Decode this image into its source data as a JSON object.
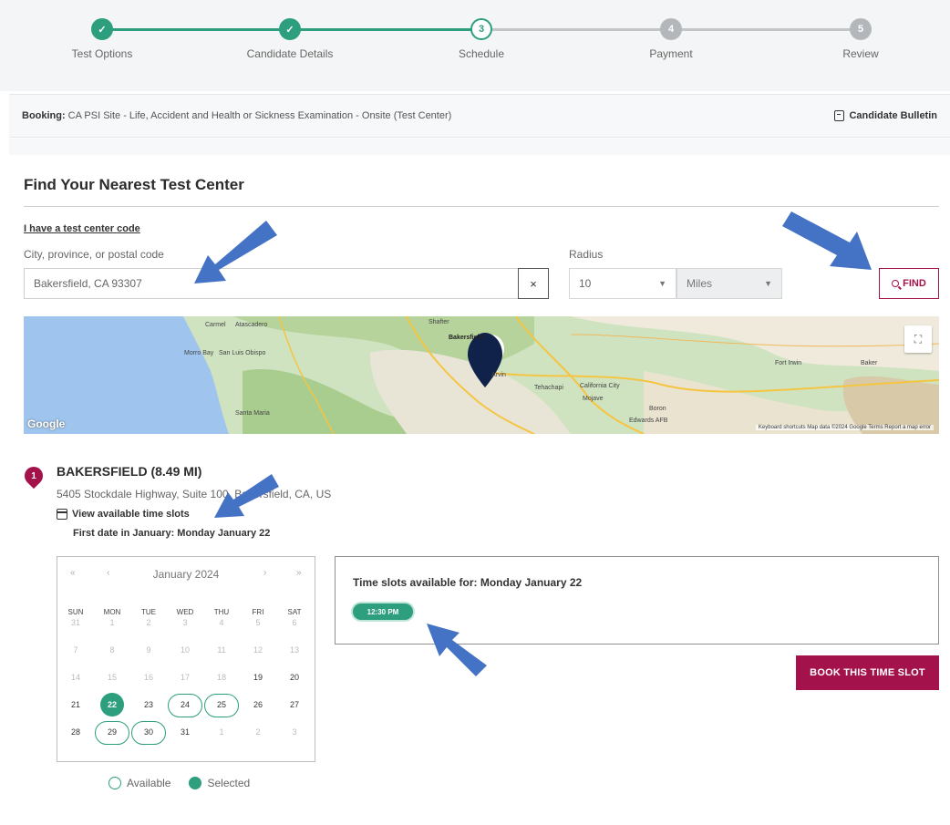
{
  "stepper": {
    "steps": [
      {
        "label": "Test Options",
        "state": "done"
      },
      {
        "label": "Candidate Details",
        "state": "done"
      },
      {
        "label": "Schedule",
        "state": "current",
        "number": "3"
      },
      {
        "label": "Payment",
        "state": "todo",
        "number": "4"
      },
      {
        "label": "Review",
        "state": "todo",
        "number": "5"
      }
    ]
  },
  "booking": {
    "label": "Booking:",
    "value": "CA PSI Site - Life, Accident and Health or Sickness Examination - Onsite (Test Center)",
    "bulletin": "Candidate Bulletin"
  },
  "find": {
    "title": "Find Your Nearest Test Center",
    "code_link": "I have a test center code",
    "city_label": "City, province, or postal code",
    "city_value": "Bakersfield, CA 93307",
    "clear": "×",
    "radius_label": "Radius",
    "radius_value": "10",
    "unit_value": "Miles",
    "find_button": "FIND"
  },
  "map": {
    "google": "Google",
    "footer": "Keyboard shortcuts   Map data ©2024 Google   Terms   Report a map error",
    "expand": "⛶",
    "towns": [
      "Carmel",
      "Atascadero",
      "Morro Bay",
      "San Luis Obispo",
      "Santa Maria",
      "Bakersfield",
      "Arvin",
      "Tehachapi",
      "California City",
      "Mojave",
      "Boron",
      "Edwards AFB",
      "Fort Irwin",
      "Baker",
      "Shafter"
    ]
  },
  "result": {
    "pin_number": "1",
    "name": "BAKERSFIELD (8.49 MI)",
    "address": "5405 Stockdale Highway, Suite 100, Bakersfield, CA, US",
    "slots_link": "View available time slots",
    "first_date": "First date in January: Monday January 22"
  },
  "calendar": {
    "nav_prev_year": "«",
    "nav_prev": "‹",
    "month": "January 2024",
    "nav_next": "›",
    "nav_next_year": "»",
    "weekdays": [
      "SUN",
      "MON",
      "TUE",
      "WED",
      "THU",
      "FRI",
      "SAT"
    ],
    "weeks": [
      [
        "31",
        "1",
        "2",
        "3",
        "4",
        "5",
        "6"
      ],
      [
        "7",
        "8",
        "9",
        "10",
        "11",
        "12",
        "13"
      ],
      [
        "14",
        "15",
        "16",
        "17",
        "18",
        "19",
        "20"
      ],
      [
        "21",
        "22",
        "23",
        "24",
        "25",
        "26",
        "27"
      ],
      [
        "28",
        "29",
        "30",
        "31",
        "1",
        "2",
        "3"
      ]
    ],
    "selected": "22",
    "available": [
      "24",
      "25",
      "29",
      "30"
    ]
  },
  "legend": {
    "available": "Available",
    "selected": "Selected"
  },
  "slots": {
    "title": "Time slots available for: Monday January 22",
    "times": [
      "12:30 PM"
    ],
    "book_button": "BOOK THIS TIME SLOT"
  },
  "colors": {
    "accent": "#2d9e7e",
    "brand": "#a3124a",
    "arrow": "#4472c4"
  }
}
